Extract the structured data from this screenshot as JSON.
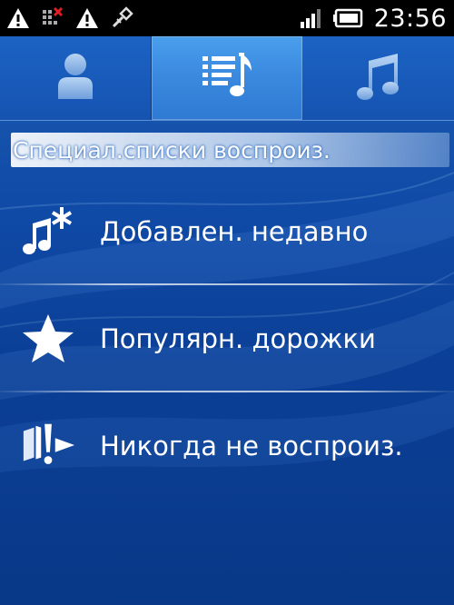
{
  "status_bar": {
    "left_icons": [
      "warning-icon",
      "signal-off-icon",
      "warning-icon",
      "usb-debug-icon"
    ],
    "right_icons": [
      "cell-signal-icon",
      "battery-icon"
    ],
    "time": "23:56"
  },
  "tabs": [
    {
      "name": "artists",
      "icon": "person-icon",
      "active": false
    },
    {
      "name": "playlists",
      "icon": "playlist-icon",
      "active": true
    },
    {
      "name": "tracks",
      "icon": "music-note-icon",
      "active": false
    }
  ],
  "section": {
    "title": "Специал.списки воспроиз."
  },
  "items": [
    {
      "label": "Добавлен. недавно",
      "icon": "recently-added-icon"
    },
    {
      "label": "Популярн. дорожки",
      "icon": "star-icon"
    },
    {
      "label": "Никогда не воспроиз.",
      "icon": "never-played-icon"
    }
  ],
  "colors": {
    "background": "#0f4aa6",
    "active_tab": "#3b8ae0",
    "status_bar": "#000000"
  }
}
